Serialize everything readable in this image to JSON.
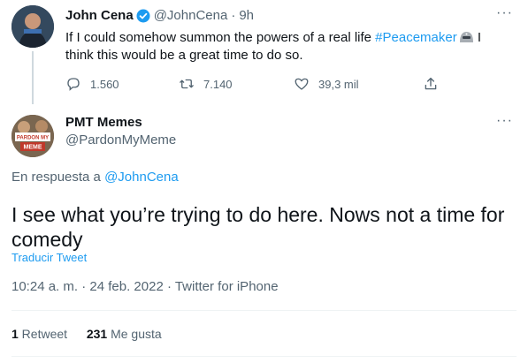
{
  "original_tweet": {
    "author_name": "John Cena",
    "handle": "@JohnCena",
    "separator": "·",
    "time": "9h",
    "text_before": "If I could somehow summon the powers of a real life ",
    "hashtag": "#Peacemaker",
    "text_after": " I think this would be a great time to do so.",
    "reply_count": "1.560",
    "retweet_count": "7.140",
    "like_count": "39,3 mil",
    "more_icon": "more-icon",
    "verified_icon": "verified-badge-icon",
    "emoji_icon": "peacemaker-helmet-emoji"
  },
  "reply_tweet": {
    "author_name": "PMT Memes",
    "handle": "@PardonMyMeme",
    "reply_to_prefix": "En respuesta a ",
    "reply_to_handle": "@JohnCena",
    "text": "I see what you’re trying to do here. Nows not a time for comedy",
    "translate_label": "Traducir Tweet",
    "timestamp": "10:24 a. m. · 24 feb. 2022 · Twitter for iPhone",
    "retweets_value": "1",
    "retweets_label": " Retweet",
    "likes_value": "231",
    "likes_label": " Me gusta",
    "avatar_badge_top": "PARDON MY",
    "avatar_badge_bottom": "MEME"
  },
  "colors": {
    "link": "#1d9bf0",
    "secondary_text": "#536471",
    "primary_text": "#0f1419",
    "divider": "#eff3f4"
  }
}
